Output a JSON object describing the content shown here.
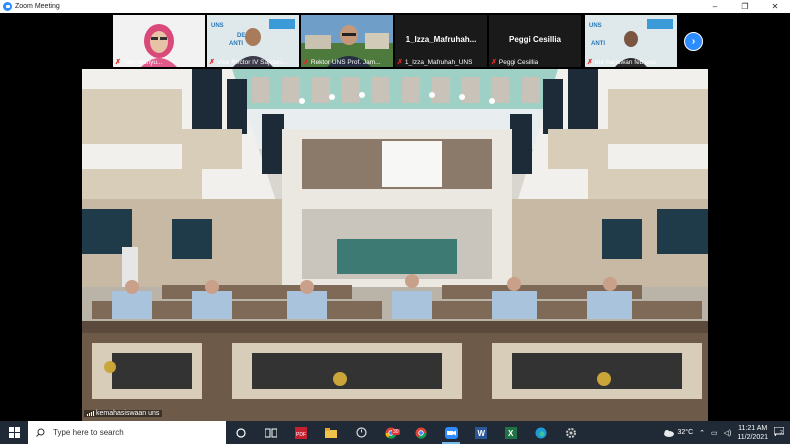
{
  "window": {
    "title": "Zoom Meeting",
    "controls": [
      "–",
      "❐",
      "✕"
    ]
  },
  "participants": [
    {
      "name": "Tetri Wahyu...",
      "muted": true,
      "type": "video"
    },
    {
      "name": "Vice Rector IV Sajidan...",
      "muted": true,
      "type": "video",
      "banner": "DESI... UNS ANTI...RASAN"
    },
    {
      "name": "Rektor UNS Prof. Jam...",
      "muted": true,
      "type": "video"
    },
    {
      "name": "1_Izza_Mafruhah_UNS",
      "muted": true,
      "type": "name",
      "display": "1_Izza_Mafruhah..."
    },
    {
      "name": "Peggi Cesillia",
      "muted": true,
      "type": "name",
      "display": "Peggi Cesillia"
    },
    {
      "name": "nur hariawan feb uns",
      "muted": true,
      "type": "video",
      "banner": "ANTI...RASAN"
    }
  ],
  "next_page_icon": "chevron-right-icon",
  "main_video": {
    "speaker_label": "kemahasiswaan uns"
  },
  "taskbar": {
    "search_placeholder": "Type here to search",
    "apps": [
      "task-view-icon",
      "snipping-icon",
      "pdf-icon",
      "file-explorer-icon",
      "clock-app-icon",
      "chrome-icon",
      "chrome-icon-2",
      "zoom-icon",
      "word-icon",
      "excel-icon",
      "edge-icon",
      "settings-icon"
    ],
    "badge": "30",
    "weather": "32°C",
    "time": "11:21 AM",
    "date": "11/2/2021",
    "notification_count": "2",
    "colors": {
      "taskbar": "#1f2a36",
      "accent": "#2d8cff"
    }
  }
}
